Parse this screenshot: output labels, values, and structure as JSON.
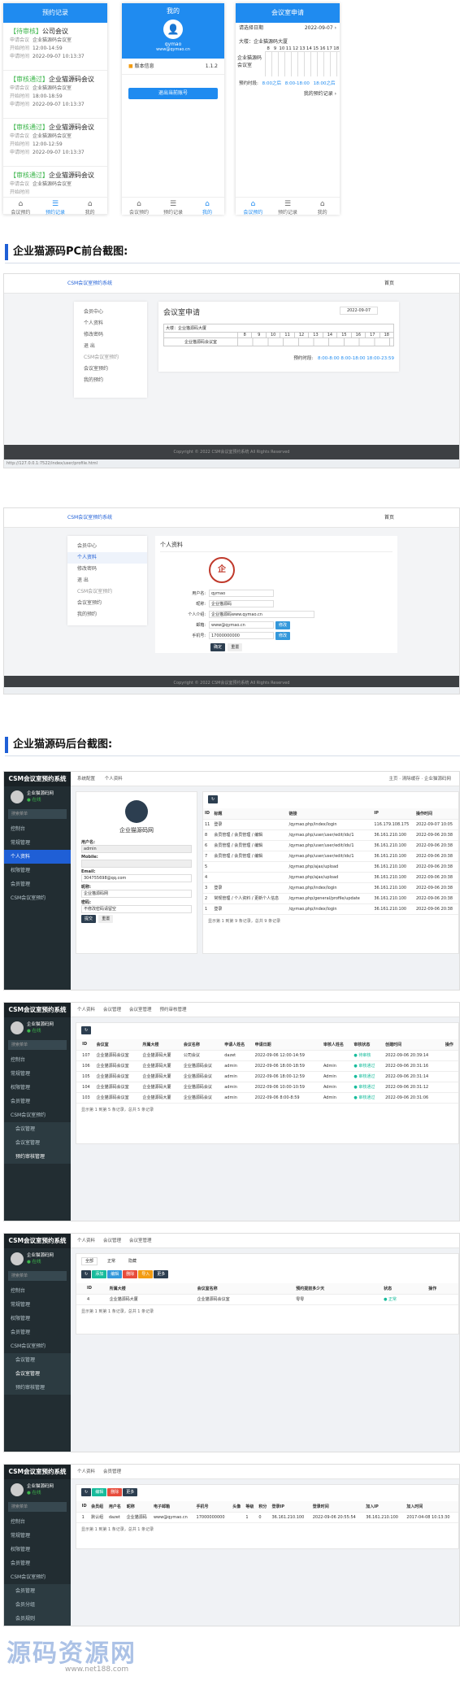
{
  "mobile": {
    "records": {
      "title": "预约记录",
      "items": [
        {
          "status": "【待审核】",
          "name": "公司会议",
          "room_label": "申请会议",
          "room": "企业猫源码会议室",
          "start_label": "开始时间",
          "start": "12:00-14:59",
          "date_label": "申请时间",
          "date": "2022-09-07 10:13:37"
        },
        {
          "status": "【审核通过】",
          "name": "企业猫源码会议",
          "room_label": "申请会议",
          "room": "企业猫源码会议室",
          "start_label": "开始时间",
          "start": "18:00-18:59",
          "date_label": "申请时间",
          "date": "2022-09-07 10:13:37"
        },
        {
          "status": "【审核通过】",
          "name": "企业猫源码会议",
          "room_label": "申请会议",
          "room": "企业猫源码会议室",
          "start_label": "开始时间",
          "start": "12:00-12:59",
          "date_label": "申请时间",
          "date": "2022-09-07 10:13:37"
        },
        {
          "status": "【审核通过】",
          "name": "企业猫源码会议",
          "room_label": "申请会议",
          "room": "企业猫源码会议室",
          "start_label": "开始时间",
          "start": "",
          "date_label": "",
          "date": ""
        }
      ],
      "tabs": [
        "会议预约",
        "预约记录",
        "我的"
      ]
    },
    "profile": {
      "title": "我的",
      "user": "qymao",
      "email": "www@qymao.cn",
      "version_label": "版本信息",
      "version": "1.1.2",
      "logout": "退出当前账号",
      "tabs": [
        "会议预约",
        "预约记录",
        "我的"
      ]
    },
    "room": {
      "title": "会议室申请",
      "date_label": "请选择日期",
      "date": "2022-09-07 ›",
      "building": "大楼：企业猫源码大厦",
      "hours": [
        "8",
        "9",
        "10",
        "11",
        "12",
        "13",
        "14",
        "15",
        "16",
        "17",
        "18"
      ],
      "room_name": "企业猫源码会议室",
      "reserved_label": "预约时段:",
      "reserved": [
        "8:00之后",
        "8:00-18:00",
        "18:00之后"
      ],
      "my_label": "我的预约记录 ›",
      "tabs": [
        "会议预约",
        "预约记录",
        "我的"
      ]
    }
  },
  "section_pc": "企业猫源码PC前台截图:",
  "section_admin": "企业猫源码后台截图:",
  "pc1": {
    "brand": "CSM会议室预约系统",
    "top_right": "首页",
    "menu": [
      "会员中心",
      "个人资料",
      "修改密码",
      "退 出",
      "CSM会议室预约",
      "会议室预约",
      "我的预约"
    ],
    "card_title": "会议室申请",
    "date": "2022-09-07",
    "building": "大楼：企业猫源码大厦",
    "hours": [
      "8",
      "9",
      "10",
      "11",
      "12",
      "13",
      "14",
      "15",
      "16",
      "17",
      "18"
    ],
    "room_name": "企业猫源码会议室",
    "reserved_label": "预约时段:",
    "reserved": "8:00-8:00  8:00-18:00  18:00-23:59",
    "footer": "Copyright © 2022 CSM会议室预约系统 All Rights Reserved",
    "status": "http://127.0.0.1:7522/index/user/profile.html"
  },
  "pc2": {
    "brand": "CSM会议室预约系统",
    "top_right": "首页",
    "menu": [
      "会员中心",
      "个人资料",
      "修改密码",
      "退 出",
      "CSM会议室预约",
      "会议室预约",
      "我的预约"
    ],
    "card_title": "个人资料",
    "fields": [
      {
        "label": "用户名:",
        "value": "qymao"
      },
      {
        "label": "昵称:",
        "value": "企业猫源码"
      },
      {
        "label": "个人介绍:",
        "value": "企业猫源码www.qymao.cn"
      },
      {
        "label": "邮箱:",
        "value": "www@qymao.cn"
      },
      {
        "label": "手机号:",
        "value": "17000000000"
      }
    ],
    "edit": "修改",
    "submit": "确定",
    "reset": "重置",
    "footer": "Copyright © 2022 CSM会议室预约系统 All Rights Reserved"
  },
  "admin1": {
    "logo": "CSM会议室预约系统",
    "user": "企业猫源码网",
    "online": "● 在线",
    "search": "搜索菜单",
    "menu": [
      "控制台",
      "常规管理",
      "个人资料",
      "权限管理",
      "会员管理",
      "CSM会议室预约"
    ],
    "tabs": [
      "系统配置",
      "个人资料"
    ],
    "profile_name": "企业猫源码网",
    "labels": [
      "用户名:",
      "Mobile:",
      "Email:",
      "昵称:",
      "密码:"
    ],
    "values": [
      "admin",
      "",
      "304755698@qq.com",
      "企业猫源码网",
      "不修改密码请留空"
    ],
    "submit": "提交",
    "reset": "重置",
    "cols": [
      "ID",
      "标题",
      "链接",
      "",
      "IP",
      "操作时间"
    ],
    "rows": [
      [
        "11",
        "登录",
        "/qymao.php/index/login",
        "",
        "116.179.108.175",
        "2022-09-07 10:05"
      ],
      [
        "8",
        "会员管理 / 会员管理 / 编辑",
        "/qymao.php/user/user/edit/ids/1",
        "",
        "36.161.210.100",
        "2022-09-06 20:38"
      ],
      [
        "6",
        "会员管理 / 会员管理 / 编辑",
        "/qymao.php/user/user/edit/ids/1",
        "",
        "36.161.210.100",
        "2022-09-06 20:38"
      ],
      [
        "7",
        "会员管理 / 会员管理 / 编辑",
        "/qymao.php/user/user/edit/ids/1",
        "",
        "36.161.210.100",
        "2022-09-06 20:38"
      ],
      [
        "5",
        "",
        "/qymao.php/ajax/upload",
        "",
        "36.161.210.100",
        "2022-09-06 20:38"
      ],
      [
        "4",
        "",
        "/qymao.php/ajax/upload",
        "",
        "36.161.210.100",
        "2022-09-06 20:38"
      ],
      [
        "3",
        "登录",
        "/qymao.php/index/login",
        "",
        "36.161.210.100",
        "2022-09-06 20:38"
      ],
      [
        "2",
        "常规管理 / 个人资料 / 更新个人信息",
        "/qymao.php/general/profile/update",
        "",
        "36.161.210.100",
        "2022-09-06 20:38"
      ],
      [
        "1",
        "登录",
        "/qymao.php/index/login",
        "",
        "36.161.210.100",
        "2022-09-06 20:38"
      ]
    ],
    "paging": "显示第 1 到第 9 条记录，总共 9 条记录",
    "top_right": [
      "主页",
      "清除缓存",
      "企业猫源码网"
    ]
  },
  "admin2": {
    "tabs": [
      "个人资料",
      "会议管理",
      "会议室管理",
      "预约审核管理"
    ],
    "menu": [
      "控制台",
      "常规管理",
      "权限管理",
      "会员管理",
      "CSM会议室预约",
      "会议管理",
      "会议室管理",
      "预约审核管理"
    ],
    "cols": [
      "",
      "ID",
      "会议室",
      "所属大楼",
      "会议名称",
      "申请人姓名",
      "申请日期",
      "审核人姓名",
      "审核状态",
      "创建时间",
      "操作"
    ],
    "rows": [
      [
        "",
        "107",
        "企业猫源码会议室",
        "企业猫源码大厦",
        "公司会议",
        "dazet",
        "2022-09-06 12:00-14:59",
        "",
        "● 待审核",
        "2022-09-06 20:39:14",
        ""
      ],
      [
        "",
        "106",
        "企业猫源码会议室",
        "企业猫源码大厦",
        "企业猫源码会议",
        "admin",
        "2022-09-06 18:00-18:59",
        "Admin",
        "● 审核通过",
        "2022-09-06 20:31:16",
        ""
      ],
      [
        "",
        "105",
        "企业猫源码会议室",
        "企业猫源码大厦",
        "企业猫源码会议",
        "admin",
        "2022-09-06 18:00-12:59",
        "Admin",
        "● 审核通过",
        "2022-09-06 20:31:14",
        ""
      ],
      [
        "",
        "104",
        "企业猫源码会议室",
        "企业猫源码大厦",
        "企业猫源码会议",
        "admin",
        "2022-09-06 10:00-10:59",
        "Admin",
        "● 审核通过",
        "2022-09-06 20:31:12",
        ""
      ],
      [
        "",
        "103",
        "企业猫源码会议室",
        "企业猫源码大厦",
        "企业猫源码会议",
        "admin",
        "2022-09-06 8:00-8:59",
        "Admin",
        "● 审核通过",
        "2022-09-06 20:31:06",
        ""
      ]
    ],
    "paging": "显示第 1 到第 5 条记录，总共 5 条记录"
  },
  "admin3": {
    "tabs": [
      "个人资料",
      "会议管理",
      "会议室管理"
    ],
    "menu": [
      "控制台",
      "常规管理",
      "权限管理",
      "会员管理",
      "CSM会议室预约",
      "会议管理",
      "会议室管理",
      "预约审核管理"
    ],
    "subtabs": [
      "全部",
      "正常",
      "隐藏"
    ],
    "buttons": [
      "添加",
      "编辑",
      "删除",
      "导入",
      "更多"
    ],
    "cols": [
      "",
      "ID",
      "所属大楼",
      "会议室名称",
      "预约提前多少天",
      "状态",
      "操作"
    ],
    "row": [
      "",
      "4",
      "企业猫源码大厦",
      "企业猫源码会议室",
      "零零",
      "● 正常",
      ""
    ],
    "paging": "显示第 1 到第 1 条记录，总共 1 条记录"
  },
  "admin4": {
    "tabs": [
      "个人资料",
      "会员管理"
    ],
    "menu": [
      "控制台",
      "常规管理",
      "权限管理",
      "会员管理",
      "CSM会议室预约",
      "会员管理",
      "会员分组",
      "会员规则"
    ],
    "buttons": [
      "编辑",
      "删除",
      "更多"
    ],
    "cols": [
      "",
      "ID",
      "会员组",
      "用户名",
      "昵称",
      "电子邮箱",
      "手机号",
      "头像",
      "等级",
      "积分",
      "登录IP",
      "登录时间",
      "加入IP",
      "加入时间"
    ],
    "row": [
      "",
      "1",
      "默认组",
      "dazet",
      "企业猫源码",
      "www@qymao.cn",
      "17000000000",
      "",
      "1",
      "0",
      "36.161.210.100",
      "2022-09-06 20:55:54",
      "36.161.210.100",
      "2017-04-08 10:13:30"
    ],
    "paging": "显示第 1 到第 1 条记录，总共 1 条记录"
  },
  "watermark": "源码资源网",
  "watermark_url": "www.net188.com"
}
